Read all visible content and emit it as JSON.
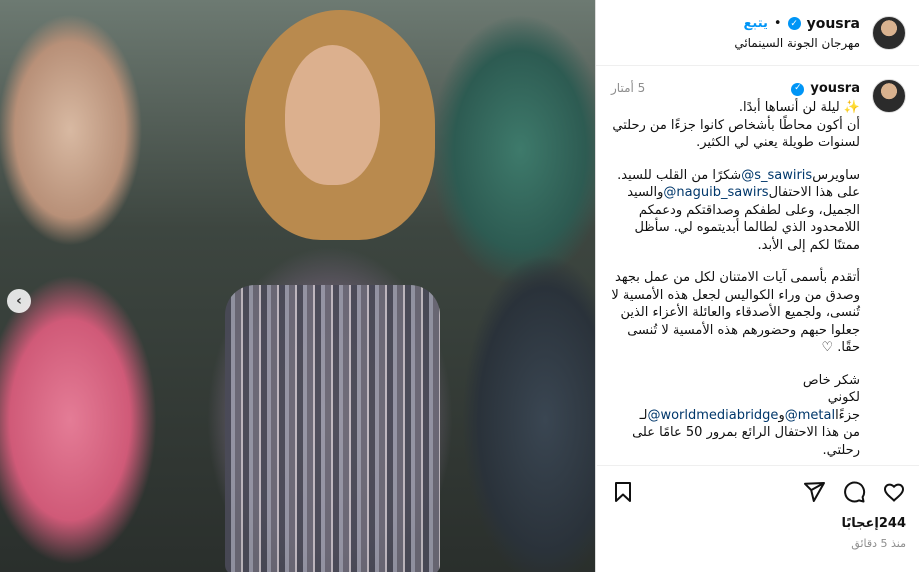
{
  "media": {
    "prev_arrow": "‹"
  },
  "header": {
    "username": "yousra",
    "follow_label": "يتبع",
    "separator": "•",
    "location": "مهرجان الجونة السينمائي"
  },
  "caption": {
    "username": "yousra",
    "time": "5 أمتار",
    "line1": "✨ ليلة لن أنساها أبدًا.",
    "line2": "أن أكون محاطًا بأشخاص كانوا جزءًا من رحلتي لسنوات طويلة يعني لي الكثير.",
    "p2_pre": "ساويرس",
    "p2_mention1": "@s_sawiris",
    "p2_mid": "شكرًا من القلب للسيد. على هذا الاحتفال",
    "p2_mention2": "@naguib_sawirs",
    "p2_post": "والسيد الجميل، وعلى لطفكم وصداقتكم ودعمكم اللامحدود الذي لطالما أبديتموه لي. سأظل ممتنًا لكم إلى الأبد.",
    "p3": "أتقدم بأسمى آيات الامتنان لكل من عمل بجهد وصدق من وراء الكواليس لجعل هذه الأمسية لا تُنسى، ولجميع الأصدقاء والعائلة الأعزاء الذين جعلوا حبهم وحضورهم هذه الأمسية لا تُنسى حقًا. ♡",
    "p4_title": "شكر خاص",
    "p4_pre": "لكوني جزءًا",
    "p4_mention1": "@metal",
    "p4_and": "و",
    "p4_mention2": "@worldmediabridge",
    "p4_to": "لـ",
    "p4_post": "من هذا الاحتفال الرائع بمرور 50 عامًا على رحلتي."
  },
  "actions": {
    "like_icon": "heart-icon",
    "comment_icon": "comment-icon",
    "share_icon": "share-icon",
    "save_icon": "bookmark-icon",
    "likes": "244إعجابًا",
    "ago": "منذ 5 دقائق"
  }
}
